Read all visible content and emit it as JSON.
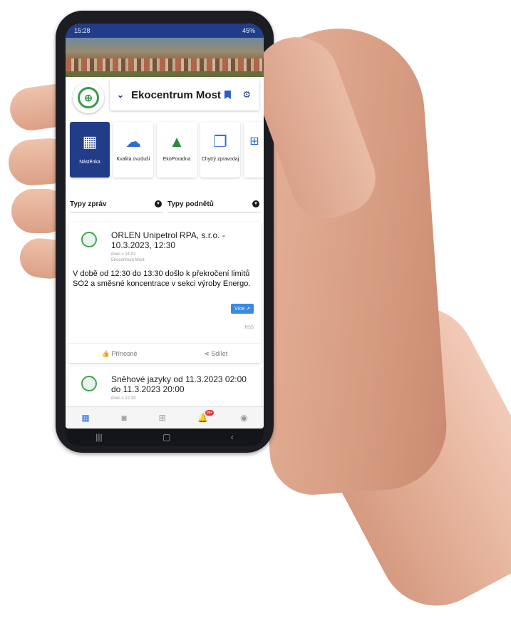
{
  "status_bar": {
    "time": "15:28",
    "right": "45%"
  },
  "header": {
    "title": "Ekocentrum Most"
  },
  "tiles": [
    {
      "label": "Nástěnka",
      "icon": "dashboard-icon",
      "active": true
    },
    {
      "label": "Kvalita ovzduší",
      "icon": "weather-icon",
      "active": false
    },
    {
      "label": "EkoPoradna",
      "icon": "trees-icon",
      "active": false
    },
    {
      "label": "Chytrý zpravodaj",
      "icon": "book-icon",
      "active": false
    }
  ],
  "filters": {
    "left": "Typy zpráv",
    "right": "Typy podnětů"
  },
  "post": {
    "title": "ORLEN Unipetrol RPA, s.r.o. - 10.3.2023, 12:30",
    "meta_time": "dnes v 14:02",
    "meta_source": "Ekocentrum Most",
    "body": "V době od 12:30 do 13:30 došlo k překročení limitů SO2 a směsné koncentrace v sekci výroby Energo.",
    "more_label": "Více",
    "source_label": "RSS",
    "like_label": "Přínosné",
    "share_label": "Sdílet"
  },
  "post2": {
    "title": "Sněhové jazyky od 11.3.2023 02:00 do 11.3.2023 20:00",
    "meta_time": "dnes v 12:33"
  },
  "bottom_nav": {
    "badge": "99+"
  },
  "colors": {
    "primary": "#213c89",
    "accent": "#2f6cd6"
  }
}
